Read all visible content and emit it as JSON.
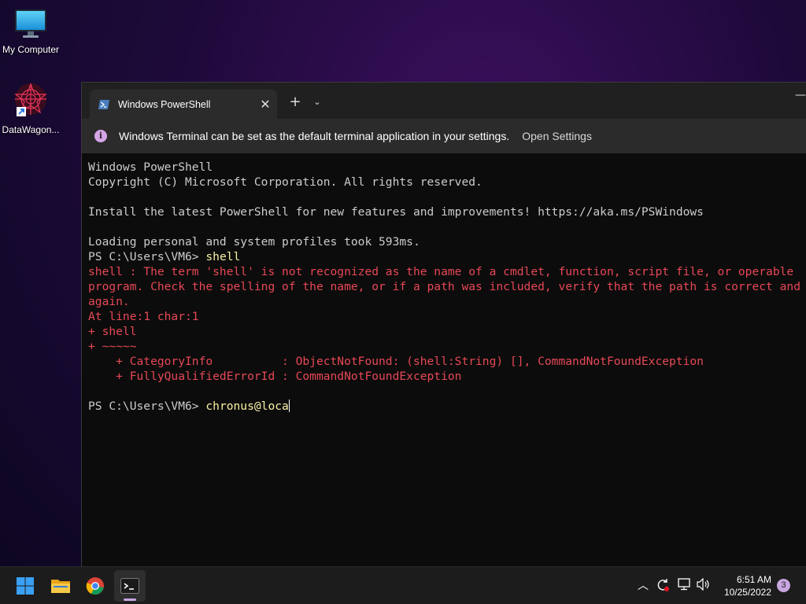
{
  "desktop": {
    "icons": [
      {
        "label": "My Computer",
        "icon": "monitor-icon"
      },
      {
        "label": "DataWagon...",
        "icon": "datawagon-icon"
      }
    ]
  },
  "terminal": {
    "tab_title": "Windows PowerShell",
    "new_tab_label": "+",
    "infobar": {
      "message": "Windows Terminal can be set as the default terminal application in your settings.",
      "link": "Open Settings",
      "icon_glyph": "i"
    },
    "lines": [
      {
        "text": "Windows PowerShell",
        "color": "white"
      },
      {
        "text": "Copyright (C) Microsoft Corporation. All rights reserved.",
        "color": "white"
      },
      {
        "text": "",
        "color": "white"
      },
      {
        "text": "Install the latest PowerShell for new features and improvements! https://aka.ms/PSWindows",
        "color": "white"
      },
      {
        "text": "",
        "color": "white"
      },
      {
        "text": "Loading personal and system profiles took 593ms.",
        "color": "white"
      },
      {
        "prompt": "PS C:\\Users\\VM6> ",
        "command": "shell"
      },
      {
        "text": "shell : The term 'shell' is not recognized as the name of a cmdlet, function, script file, or operable",
        "color": "red"
      },
      {
        "text": "program. Check the spelling of the name, or if a path was included, verify that the path is correct and try",
        "color": "red"
      },
      {
        "text": "again.",
        "color": "red"
      },
      {
        "text": "At line:1 char:1",
        "color": "red"
      },
      {
        "text": "+ shell",
        "color": "red"
      },
      {
        "text": "+ ~~~~~",
        "color": "red"
      },
      {
        "text": "    + CategoryInfo          : ObjectNotFound: (shell:String) [], CommandNotFoundException",
        "color": "red"
      },
      {
        "text": "    + FullyQualifiedErrorId : CommandNotFoundException",
        "color": "red"
      },
      {
        "text": "",
        "color": "white"
      },
      {
        "prompt": "PS C:\\Users\\VM6> ",
        "command": "chronus@loca",
        "cursor": true
      }
    ]
  },
  "taskbar": {
    "apps": [
      "start-icon",
      "file-explorer-icon",
      "chrome-icon",
      "terminal-icon"
    ],
    "tray": {
      "time": "6:51 AM",
      "date": "10/25/2022",
      "notification_count": "3"
    }
  },
  "colors": {
    "console_white": "#cccccc",
    "console_red": "#e74856",
    "console_yellow": "#f9f1a5",
    "accent": "#c8a6e0"
  }
}
